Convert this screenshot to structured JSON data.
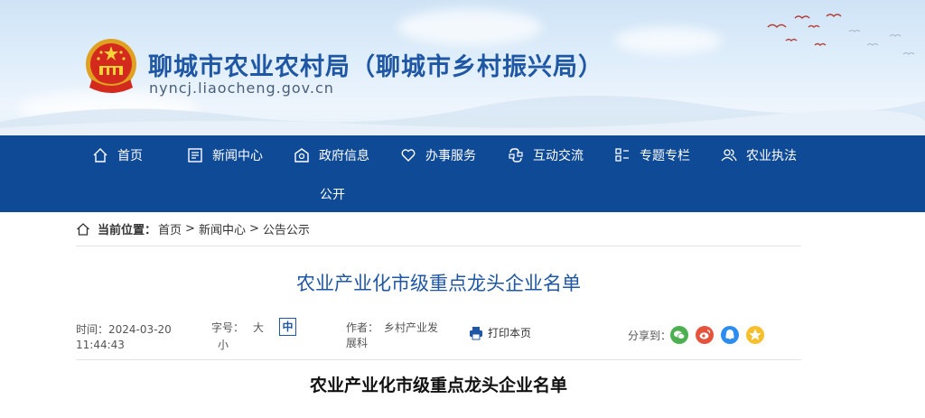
{
  "header": {
    "site_title": "聊城市农业农村局（聊城市乡村振兴局）",
    "site_url": "nyncj.liaocheng.gov.cn",
    "emblem_icon": "national-emblem-icon"
  },
  "nav": {
    "items": [
      {
        "label": "首页",
        "icon": "home-icon"
      },
      {
        "label": "新闻中心",
        "icon": "news-icon"
      },
      {
        "label": "政府信息",
        "icon": "government-info-icon"
      },
      {
        "label": "办事服务",
        "icon": "heart-icon"
      },
      {
        "label": "互动交流",
        "icon": "interaction-icon"
      },
      {
        "label": "专题专栏",
        "icon": "grid-icon"
      },
      {
        "label": "农业执法",
        "icon": "users-icon"
      }
    ],
    "sub_label": "公开",
    "background": "#0f4a97"
  },
  "breadcrumb": {
    "label": "当前位置：",
    "items": [
      "首页",
      "新闻中心",
      "公告公示"
    ],
    "separator": ">"
  },
  "article": {
    "title": "农业产业化市级重点龙头企业名单",
    "time_label": "时间：",
    "date": "2024-03-20",
    "time": "11:44:43",
    "fontsize_label": "字号：",
    "fontsize_large": "大",
    "fontsize_medium": "中",
    "fontsize_small": "小",
    "author_label": "作者：",
    "author_line1": "乡村产业发",
    "author_line2": "展科",
    "print_label": "打印本页",
    "share_label": "分享到：",
    "share_icons": [
      "wechat-icon",
      "weibo-icon",
      "qq-icon",
      "qzone-icon"
    ],
    "content_title": "农业产业化市级重点龙头企业名单"
  },
  "colors": {
    "accent": "#1f57a4",
    "wechat": "#4cb050",
    "weibo": "#e5533c",
    "qq": "#2d8cf0",
    "qzone": "#f6c02d"
  }
}
